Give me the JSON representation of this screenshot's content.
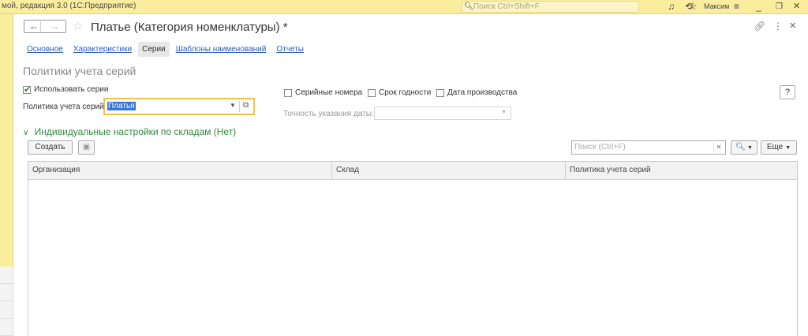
{
  "window": {
    "app_title": "мой, редакция 3.0  (1С:Предприятие)",
    "search_placeholder": "Поиск Ctrl+Shift+F",
    "user": "Максим"
  },
  "form": {
    "title": "Платье (Категория номенклатуры) *",
    "tabs": [
      {
        "label": "Основное"
      },
      {
        "label": "Характеристики"
      },
      {
        "label": "Серии"
      },
      {
        "label": "Шаблоны наименований"
      },
      {
        "label": "Отчеты"
      }
    ],
    "active_tab": "Серии"
  },
  "series_policy": {
    "section_title": "Политики учета серий",
    "use_series_label": "Использовать серии",
    "use_series_checked": true,
    "policy_label": "Политика учета серий:",
    "policy_value": "Платья",
    "serial_numbers_label": "Серийные номера",
    "expiry_label": "Срок годности",
    "production_date_label": "Дата производства",
    "date_precision_label": "Точность указания даты:",
    "help_label": "?"
  },
  "warehouse_settings": {
    "group_title": "Индивидуальные настройки по складам (Нет)",
    "create_button": "Создать",
    "search_placeholder": "Поиск (Ctrl+F)",
    "more_button": "Еще",
    "columns": [
      "Организация",
      "Склад",
      "Политика учета серий"
    ],
    "rows": []
  },
  "colors": {
    "titlebar": "#fbed9e",
    "link": "#2a5bb0",
    "group_title": "#2e8b3e",
    "focus_border": "#f0c14b",
    "selection": "#3875d7"
  }
}
